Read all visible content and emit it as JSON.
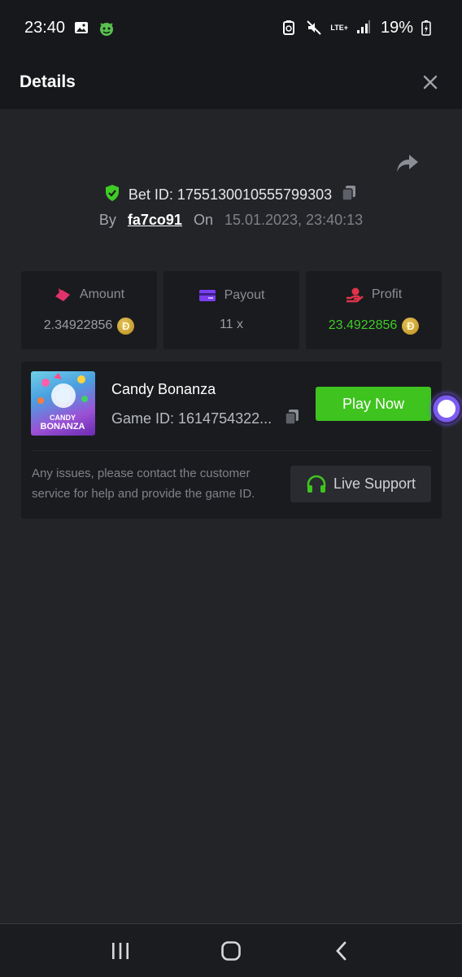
{
  "status_bar": {
    "time": "23:40",
    "network": "LTE+",
    "battery": "19%"
  },
  "header": {
    "title": "Details"
  },
  "bet": {
    "bet_id_label": "Bet ID: 1755130010555799303",
    "by_label": "By",
    "user": "fa7co91",
    "on_label": "On",
    "date": "15.01.2023, 23:40:13"
  },
  "stats": [
    {
      "label": "Amount",
      "value": "2.34922856",
      "icon": "amount-icon",
      "color": "#e0336b"
    },
    {
      "label": "Payout",
      "value": "11 x",
      "icon": "payout-icon",
      "color": "#7b3ff2"
    },
    {
      "label": "Profit",
      "value": "23.4922856",
      "icon": "profit-icon",
      "color": "#e0334a",
      "value_color": "#3fcc27"
    }
  ],
  "coin_symbol": "Ɖ",
  "game": {
    "title": "Candy Bonanza",
    "game_id_label": "Game ID: 1614754322...",
    "thumb_text_1": "CANDY",
    "thumb_text_2": "BONANZA",
    "play_label": "Play Now"
  },
  "support": {
    "text": "Any issues, please contact the customer service for help and provide the game ID.",
    "button_label": "Live Support",
    "accent": "#3fc31f"
  }
}
